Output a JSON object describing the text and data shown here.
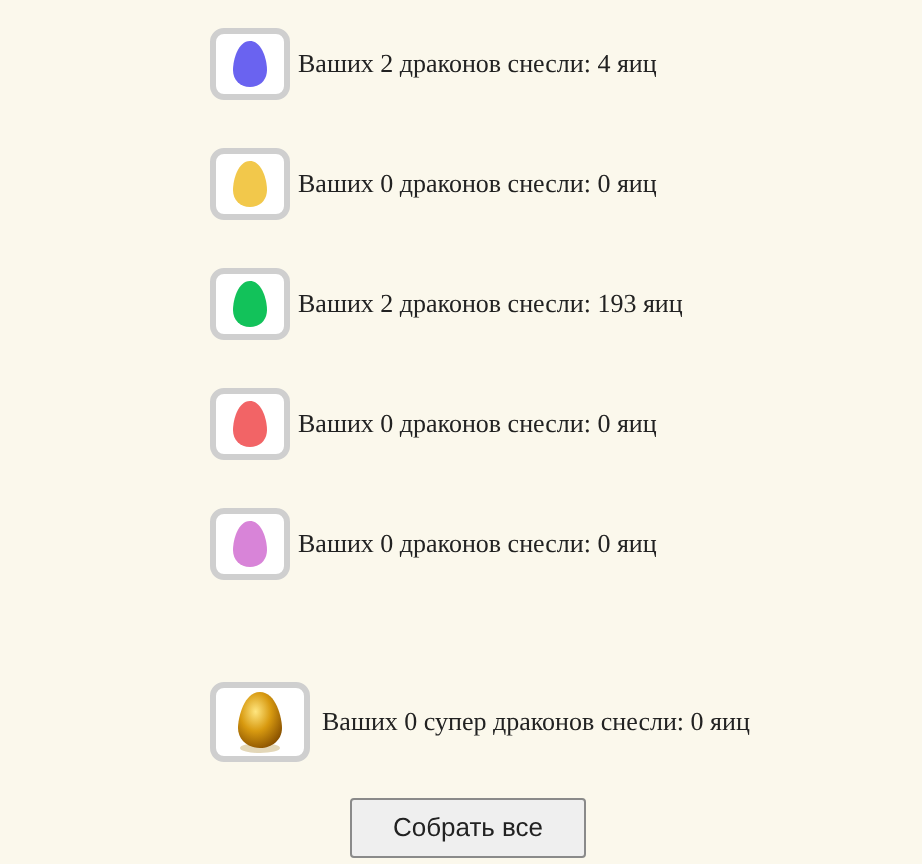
{
  "eggs": [
    {
      "kind": "plain",
      "color": "#6a63f0",
      "text": "Ваших 2 драконов снесли: 4 яиц"
    },
    {
      "kind": "plain",
      "color": "#f2c84b",
      "text": "Ваших 0 драконов снесли: 0 яиц"
    },
    {
      "kind": "plain",
      "color": "#12c25a",
      "text": "Ваших 2 драконов снесли: 193 яиц"
    },
    {
      "kind": "plain",
      "color": "#f26466",
      "text": "Ваших 0 драконов снесли: 0 яиц"
    },
    {
      "kind": "plain",
      "color": "#d884d8",
      "text": "Ваших 0 драконов снесли: 0 яиц"
    },
    {
      "kind": "golden",
      "text": "Ваших 0 супер драконов снесли: 0 яиц"
    }
  ],
  "button": "Собрать все"
}
